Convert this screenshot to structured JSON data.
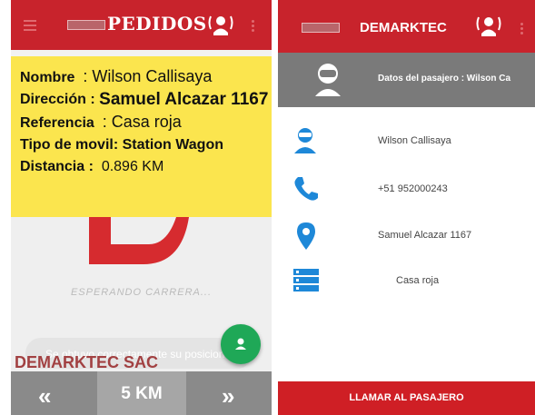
{
  "left_screen": {
    "header": {
      "title": "PEDIDOS"
    },
    "info": {
      "nombre_label": "Nombre",
      "nombre_value": ": Wilson Callisaya",
      "direccion_label": "Dirección :",
      "direccion_value": "Samuel Alcazar 1167",
      "referencia_label": "Referencia",
      "referencia_value": ": Casa roja",
      "tipo_label": "Tipo de movil:",
      "tipo_value": "Station Wagon",
      "distancia_label": "Distancia :",
      "distancia_value": "0.896 KM"
    },
    "waiting_text": "ESPERANDO CARRERA...",
    "toast_text": "Se obtuvo correctamente su posicion",
    "company": "DEMARKTEC SAC",
    "bottom": {
      "prev_glyph": "«",
      "distance": "5 KM",
      "next_glyph": "»"
    }
  },
  "right_screen": {
    "header": {
      "title": "DEMARKTEC"
    },
    "passenger_bar": "Datos del pasajero : Wilson Ca",
    "details": {
      "name": "Wilson Callisaya",
      "phone": "+51 952000243",
      "address": "Samuel Alcazar 1167",
      "reference": "Casa roja"
    },
    "call_button": "LLAMAR AL PASAJERO"
  },
  "colors": {
    "header_red": "#c8232c",
    "card_yellow": "#fbe54e",
    "icon_blue": "#1e88d8",
    "fab_green": "#1fa857",
    "company_brown": "#a24142"
  },
  "icons": {
    "menu": "hamburger-icon",
    "alert": "driver-alert-icon",
    "more": "more-vert-icon",
    "user": "user-icon",
    "phone": "phone-icon",
    "location": "location-pin-icon",
    "list": "list-icon",
    "prev": "double-chevron-left-icon",
    "next": "double-chevron-right-icon"
  }
}
